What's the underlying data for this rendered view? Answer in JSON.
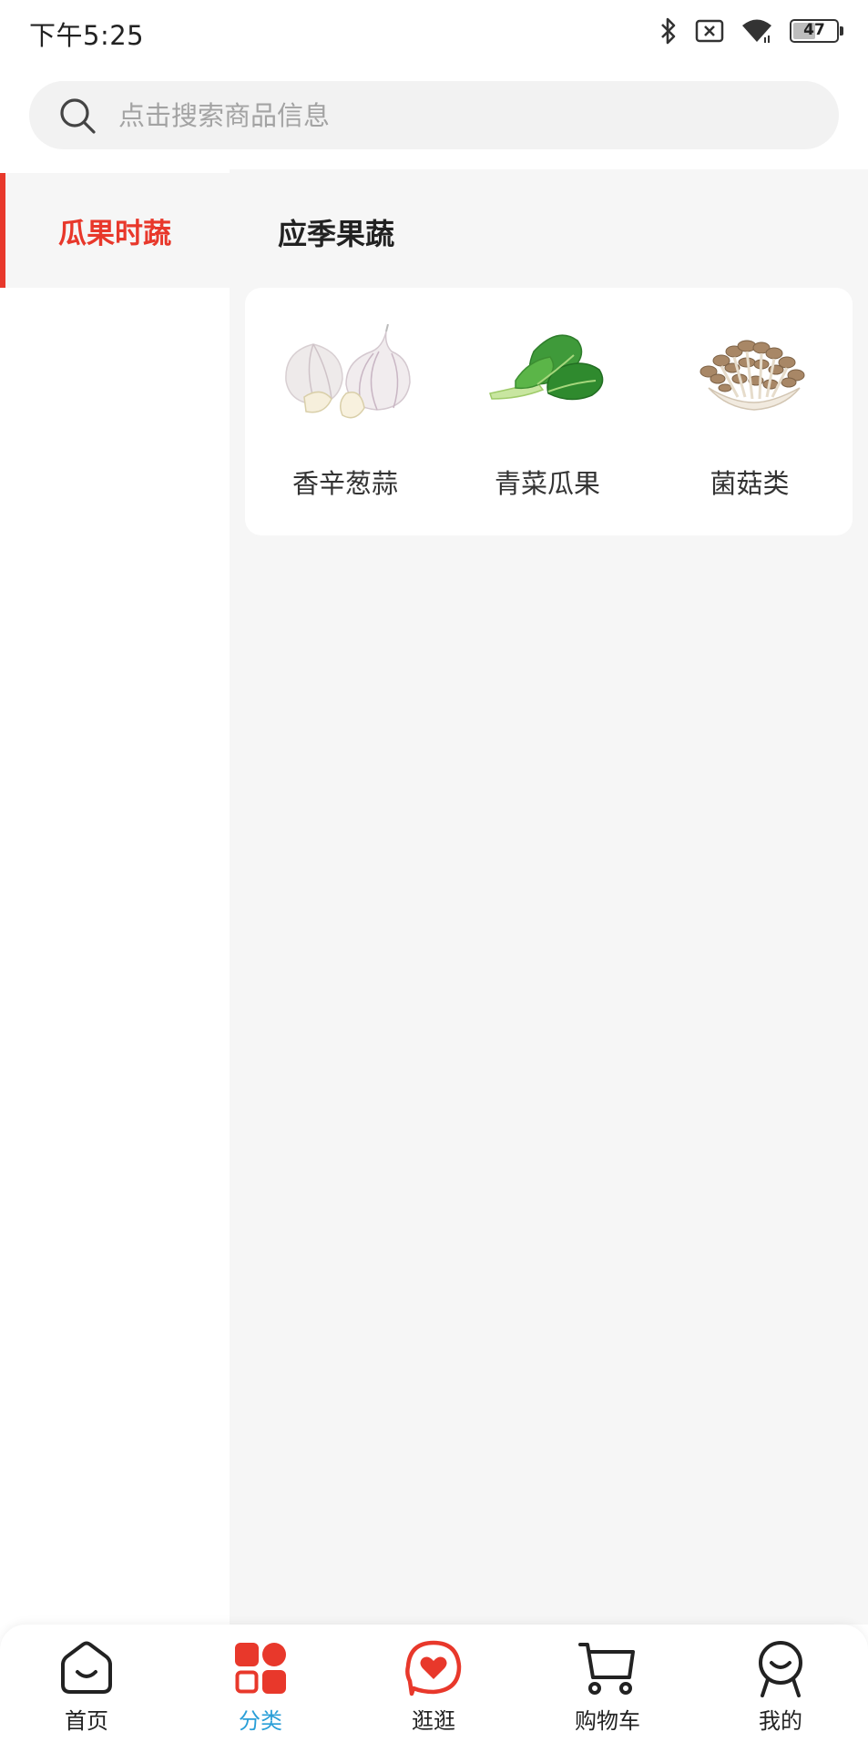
{
  "status_bar": {
    "time": "下午5:25",
    "battery": "47",
    "battery_level": 0.47,
    "icons": [
      "bluetooth-icon",
      "sim-off-icon",
      "wifi-icon",
      "battery-icon"
    ]
  },
  "search": {
    "placeholder": "点击搜索商品信息",
    "icon": "search-icon"
  },
  "sidebar": {
    "items": [
      {
        "label": "瓜果时蔬",
        "active": true
      }
    ],
    "accent_color": "#e8382b"
  },
  "main": {
    "section_title": "应季果蔬",
    "categories": [
      {
        "label": "香辛葱蒜",
        "icon": "garlic-image"
      },
      {
        "label": "青菜瓜果",
        "icon": "bok-choy-image"
      },
      {
        "label": "菌菇类",
        "icon": "mushroom-image"
      }
    ]
  },
  "tabbar": {
    "items": [
      {
        "label": "首页",
        "icon": "home-icon"
      },
      {
        "label": "分类",
        "icon": "category-icon",
        "active": true
      },
      {
        "label": "逛逛",
        "icon": "heart-chat-icon"
      },
      {
        "label": "购物车",
        "icon": "cart-icon"
      },
      {
        "label": "我的",
        "icon": "profile-icon"
      }
    ],
    "active_color": "#2a9fd8"
  }
}
